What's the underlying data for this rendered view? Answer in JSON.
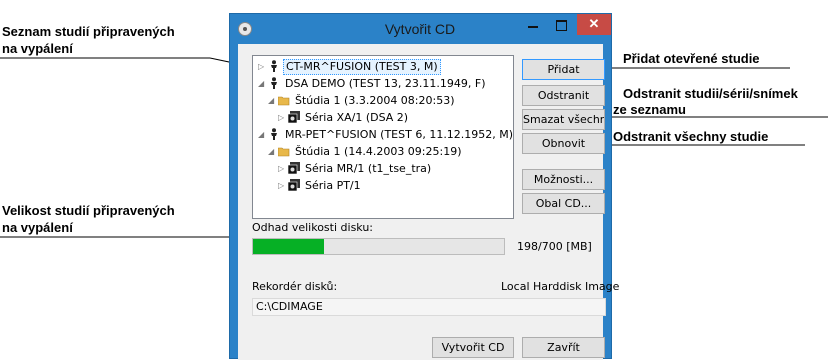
{
  "annotations": {
    "list_label_1": "Seznam studií připravených",
    "list_label_2": "na vypálení",
    "size_label_1": "Velikost studií připravených",
    "size_label_2": "na vypálení",
    "add_label": "Přidat otevřené studie",
    "remove_label_1": "Odstranit studii/sérii/snímek",
    "remove_label_2": "ze seznamu",
    "clear_label": "Odstranit všechny studie"
  },
  "window": {
    "title": "Vytvořit CD",
    "close_glyph": "✕"
  },
  "tree": [
    {
      "label": "CT-MR^FUSION (TEST 3, M)",
      "icon": "person-icon",
      "expander": "▷",
      "selected": true
    },
    {
      "label": "DSA DEMO (TEST 13, 23.11.1949, F)",
      "icon": "person-icon",
      "expander": "◢"
    },
    {
      "label": "Štúdia 1 (3.3.2004 08:20:53)",
      "icon": "folder-icon",
      "expander": "◢"
    },
    {
      "label": "Séria XA/1 (DSA 2)",
      "icon": "series-icon",
      "expander": "▷"
    },
    {
      "label": "MR-PET^FUSION (TEST 6, 11.12.1952, M)",
      "icon": "person-icon",
      "expander": "◢"
    },
    {
      "label": "Štúdia 1 (14.4.2003 09:25:19)",
      "icon": "folder-icon",
      "expander": "◢"
    },
    {
      "label": "Séria MR/1 (t1_tse_tra)",
      "icon": "series-icon",
      "expander": "▷"
    },
    {
      "label": "Séria PT/1",
      "icon": "series-icon",
      "expander": "▷"
    }
  ],
  "buttons": {
    "add": "Přidat",
    "remove": "Odstranit",
    "clear": "Smazat všechno",
    "refresh": "Obnovit",
    "options": "Možnosti...",
    "cover": "Obal CD...",
    "create": "Vytvořit CD",
    "close": "Zavřít"
  },
  "disk": {
    "estimate_label": "Odhad velikosti disku:",
    "size_text": "198/700 [MB]",
    "used_fraction": 0.283,
    "fill_color": "#06b025"
  },
  "recorder": {
    "label": "Rekordér disků:",
    "device": "Local Harddisk Image",
    "path": "C:\\CDIMAGE"
  }
}
